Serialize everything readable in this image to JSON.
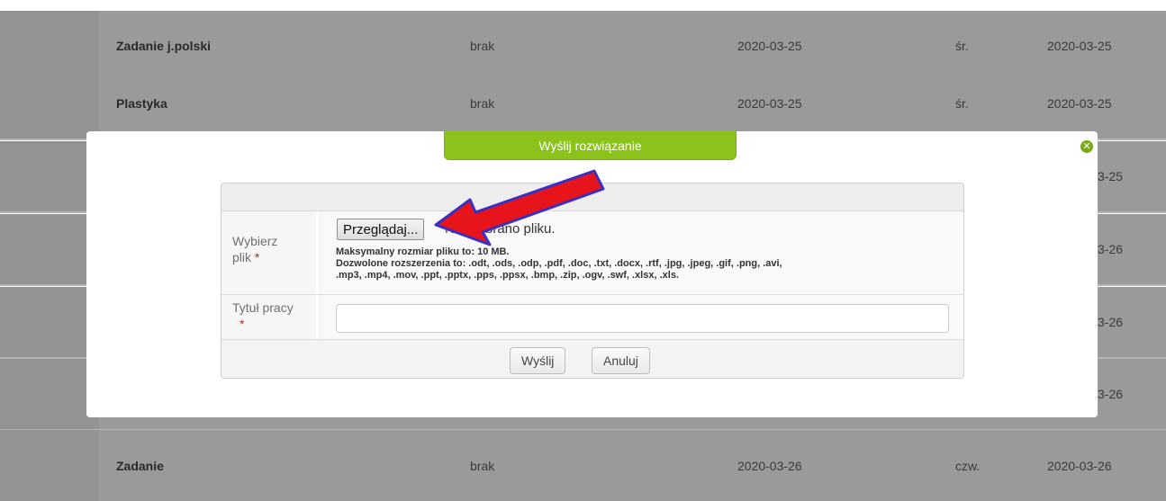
{
  "table": {
    "rows": [
      {
        "subject": "Zadanie j.polski",
        "status": "brak",
        "date1": "2020-03-25",
        "day": "śr.",
        "date2": "2020-03-25"
      },
      {
        "subject": "Plastyka",
        "status": "brak",
        "date1": "2020-03-25",
        "day": "śr.",
        "date2": "2020-03-25"
      },
      {
        "subject": "",
        "status": "",
        "date1": "",
        "day": "",
        "date2": "3-25"
      },
      {
        "subject": "",
        "status": "",
        "date1": "",
        "day": "",
        "date2": "3-26"
      },
      {
        "subject": "",
        "status": "",
        "date1": "",
        "day": "",
        "date2": "3-26"
      },
      {
        "subject": "",
        "status": "",
        "date1": "",
        "day": "",
        "date2": "3-26"
      },
      {
        "subject": "Zadanie",
        "status": "brak",
        "date1": "2020-03-26",
        "day": "czw.",
        "date2": "2020-03-26"
      }
    ]
  },
  "modal": {
    "title": "Wyślij rozwiązanie",
    "close_icon": "x-circle-icon",
    "accent_color": "#8cc21b",
    "file_row": {
      "label": "Wybierz plik",
      "required_mark": "*",
      "browse_label": "Przeglądaj...",
      "no_file_text": "Nie wybrano pliku.",
      "max_size_hint": "Maksymalny rozmiar pliku to: 10 MB.",
      "extensions_hint_line1": "Dozwolone rozszerzenia to: .odt, .ods, .odp, .pdf, .doc, .txt, .docx, .rtf, .jpg, .jpeg, .gif, .png, .avi,",
      "extensions_hint_line2": ".mp3, .mp4, .mov, .ppt, .pptx, .pps, .ppsx, .bmp, .zip, .ogv, .swf, .xlsx, .xls."
    },
    "title_row": {
      "label": "Tytuł pracy",
      "required_mark": "*",
      "value": ""
    },
    "actions": {
      "submit_label": "Wyślij",
      "cancel_label": "Anuluj"
    }
  },
  "annotation": {
    "arrow_color": "#e8141c",
    "arrow_icon": "red-arrow-annotation"
  }
}
